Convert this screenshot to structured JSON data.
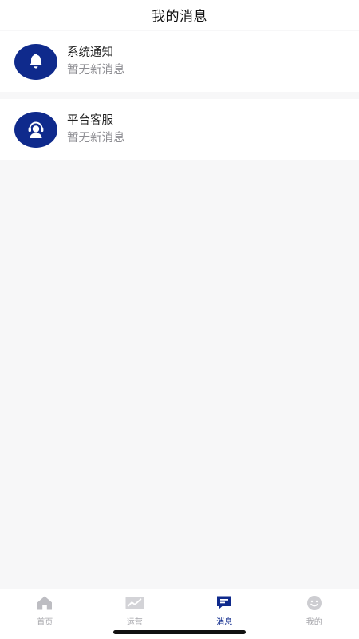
{
  "header": {
    "title": "我的消息"
  },
  "messages": [
    {
      "title": "系统通知",
      "subtitle": "暂无新消息",
      "icon": "bell-icon"
    },
    {
      "title": "平台客服",
      "subtitle": "暂无新消息",
      "icon": "customer-service-icon"
    }
  ],
  "tabbar": {
    "active": "消息",
    "items": [
      {
        "label": "首页",
        "icon": "home-icon"
      },
      {
        "label": "运营",
        "icon": "chart-icon"
      },
      {
        "label": "消息",
        "icon": "message-icon"
      },
      {
        "label": "我的",
        "icon": "smiley-icon"
      }
    ]
  },
  "colors": {
    "accent": "#0f2a8c",
    "inactive": "#a8a8ad",
    "background": "#f7f7f8"
  }
}
